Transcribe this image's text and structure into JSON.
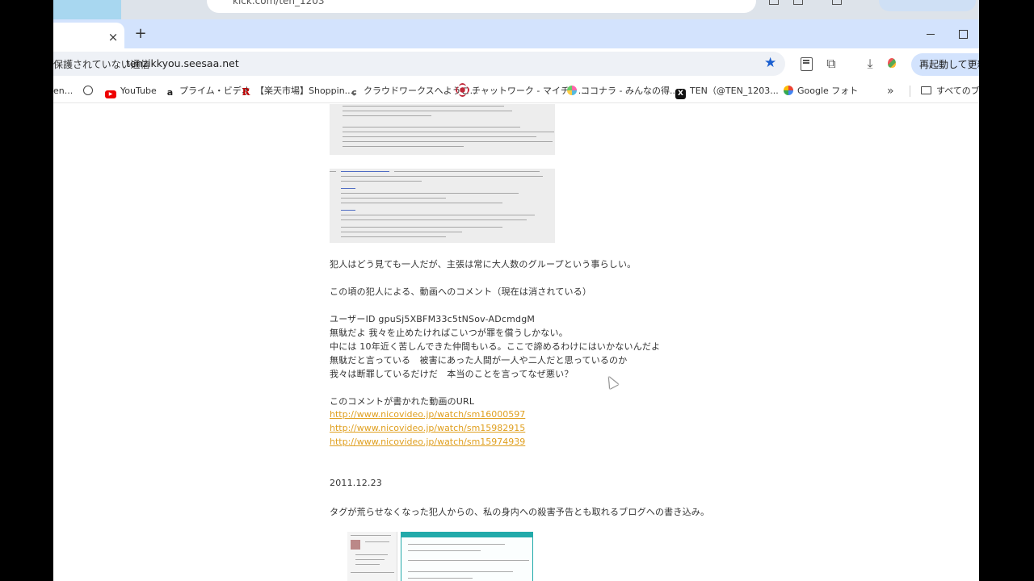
{
  "background_window": {
    "url_fragment": "kick.com/ten_1203",
    "relaunch_label": "再起動して更新する"
  },
  "tabs": {
    "close_glyph": "×",
    "new_tab_glyph": "+"
  },
  "toolbar": {
    "security_chip": "保護されていない通信",
    "url": "tenzikkyou.seesaa.net",
    "star_glyph": "★",
    "relaunch_label": "再起動して更新す"
  },
  "bookmarks": {
    "items": [
      {
        "label": "en..."
      },
      {
        "label": ""
      },
      {
        "label": "YouTube"
      },
      {
        "label": "プライム・ビデオ"
      },
      {
        "label": "【楽天市場】Shoppin..."
      },
      {
        "label": "クラウドワークスへようこ..."
      },
      {
        "label": "チャットワーク - マイチャ..."
      },
      {
        "label": "ココナラ - みんなの得..."
      },
      {
        "label": "TEN（@TEN_1203..."
      },
      {
        "label": "Google フォト"
      }
    ],
    "more_glyph": "»",
    "all_bookmarks": "すべてのブッ"
  },
  "article": {
    "para1": "犯人はどう見ても一人だが、主張は常に大人数のグループという事らしい。",
    "para2": "この頃の犯人による、動画へのコメント（現在は消されている）",
    "comment_lines": [
      "ユーザーID gpuSj5XBFM33c5tNSov-ADcmdgM",
      "無駄だよ 我々を止めたければこいつが罪を償うしかない。",
      "中には 10年近く苦しんできた仲間もいる。ここで諦めるわけにはいかないんだよ",
      "無駄だと言っている　被害にあった人間が一人や二人だと思っているのか",
      "我々は断罪しているだけだ　本当のことを言ってなぜ悪い？"
    ],
    "url_intro": "このコメントが書かれた動画のURL",
    "links": [
      "http://www.nicovideo.jp/watch/sm16000597",
      "http://www.nicovideo.jp/watch/sm15982915",
      "http://www.nicovideo.jp/watch/sm15974939"
    ],
    "date": "2011.12.23",
    "para3": "タグが荒らせなくなった犯人からの、私の身内への殺害予告とも取れるブログへの書き込み。"
  }
}
